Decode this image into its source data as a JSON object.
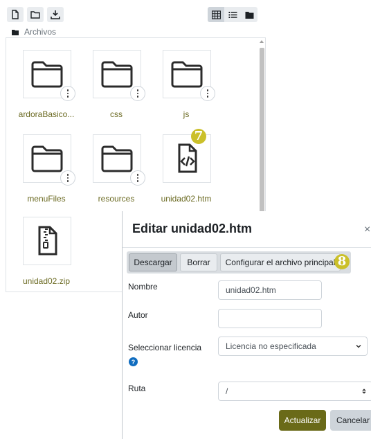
{
  "toolbar": {
    "icons": [
      "new-file-icon",
      "new-folder-icon",
      "download-icon"
    ],
    "views": [
      "grid-view-icon",
      "list-view-icon",
      "tree-view-icon"
    ],
    "active_view": "grid-view-icon"
  },
  "breadcrumb": {
    "folder_label": "Archivos"
  },
  "files": [
    {
      "name": "ardoraBasico...",
      "type": "folder"
    },
    {
      "name": "css",
      "type": "folder"
    },
    {
      "name": "js",
      "type": "folder"
    },
    {
      "name": "menuFiles",
      "type": "folder"
    },
    {
      "name": "resources",
      "type": "folder"
    },
    {
      "name": "unidad02.htm",
      "type": "code-file"
    },
    {
      "name": "unidad02.zip",
      "type": "zip-file"
    }
  ],
  "steps": {
    "file_step": "7",
    "main_file_step": "8"
  },
  "modal": {
    "title": "Editar unidad02.htm",
    "close": "×",
    "actions": {
      "download": "Descargar",
      "delete": "Borrar",
      "set_main": "Configurar el archivo principal"
    },
    "fields": {
      "name_label": "Nombre",
      "name_value": "unidad02.htm",
      "author_label": "Autor",
      "author_value": "",
      "license_label": "Seleccionar licencia",
      "license_value": "Licencia no especificada",
      "path_label": "Ruta",
      "path_value": "/"
    },
    "buttons": {
      "update": "Actualizar",
      "cancel": "Cancelar"
    }
  },
  "colors": {
    "accent": "#6a6a18",
    "file_link": "#6b6a22",
    "step_badge": "#cbc02a",
    "help_icon": "#0f6cbf"
  }
}
